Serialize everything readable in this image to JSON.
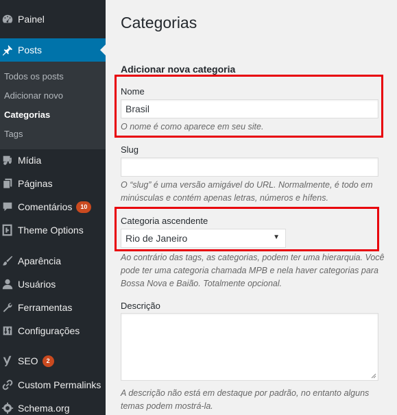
{
  "sidebar": {
    "items": [
      {
        "label": "Painel",
        "icon": "dashboard-icon"
      },
      {
        "label": "Posts",
        "icon": "pin-icon"
      },
      {
        "label": "Mídia",
        "icon": "media-icon"
      },
      {
        "label": "Páginas",
        "icon": "pages-icon"
      },
      {
        "label": "Comentários",
        "icon": "comment-icon",
        "badge": "10"
      },
      {
        "label": "Theme Options",
        "icon": "theme-options-icon"
      },
      {
        "label": "Aparência",
        "icon": "brush-icon"
      },
      {
        "label": "Usuários",
        "icon": "user-icon"
      },
      {
        "label": "Ferramentas",
        "icon": "wrench-icon"
      },
      {
        "label": "Configurações",
        "icon": "settings-icon"
      },
      {
        "label": "SEO",
        "icon": "yoast-icon",
        "badge": "2"
      },
      {
        "label": "Custom Permalinks",
        "icon": "link-icon"
      },
      {
        "label": "Schema.org",
        "icon": "gear-icon"
      }
    ],
    "submenu": [
      {
        "label": "Todos os posts"
      },
      {
        "label": "Adicionar novo"
      },
      {
        "label": "Categorias"
      },
      {
        "label": "Tags"
      }
    ]
  },
  "main": {
    "title": "Categorias",
    "section_title": "Adicionar nova categoria",
    "name": {
      "label": "Nome",
      "value": "Brasil",
      "help": "O nome é como aparece em seu site."
    },
    "slug": {
      "label": "Slug",
      "value": "",
      "help_line1": "O “slug” é uma versão amigável do URL. Normalmente, é todo em",
      "help_line2": "minúsculas e contém apenas letras, números e hífens."
    },
    "parent": {
      "label": "Categoria ascendente",
      "selected": "Rio de Janeiro",
      "help_line1": "Ao contrário das tags, as categorias, podem ter uma hierarquia. Você",
      "help_line2": "pode ter uma categoria chamada MPB e nela haver categorias para",
      "help_line3": "Bossa Nova e Baião. Totalmente opcional."
    },
    "description": {
      "label": "Descrição",
      "value": "",
      "help_line1": "A descrição não está em destaque por padrão, no entanto alguns",
      "help_line2": "temas podem mostrá-la."
    }
  },
  "colors": {
    "sidebar_bg": "#23282d",
    "submenu_bg": "#32373c",
    "active_bg": "#0073aa",
    "highlight": "#e8000b",
    "badge": "#ca4a1f"
  }
}
